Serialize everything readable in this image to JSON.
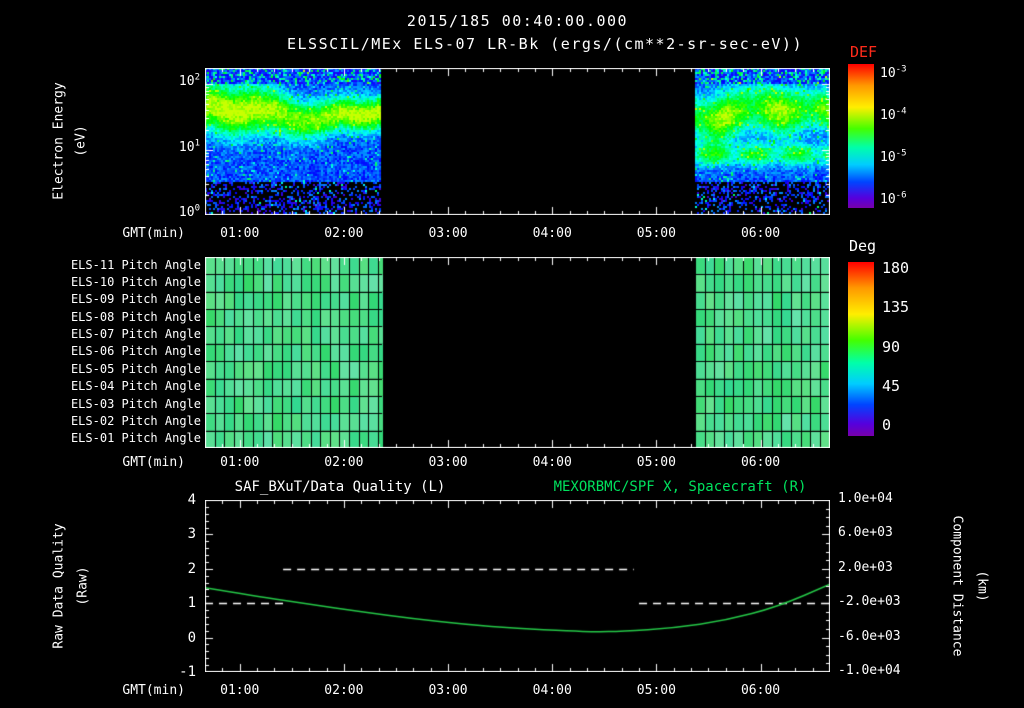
{
  "header": {
    "timestamp": "2015/185 00:40:00.000",
    "title": "ELSSCIL/MEx ELS-07 LR-Bk (ergs/(cm**2-sr-sec-eV))"
  },
  "colors": {
    "background": "#000000",
    "text": "#ffffff",
    "def_label_red": "#ff2b1a",
    "right_title_green": "#00e25e",
    "curve_green": "#25c948",
    "pitch_green": "#57e393"
  },
  "panels": {
    "spectrogram": {
      "ylabel_line1": "Electron Energy",
      "ylabel_line2": "(eV)",
      "xlabel": "GMT(min)",
      "x_ticks": [
        "01:00",
        "02:00",
        "03:00",
        "04:00",
        "05:00",
        "06:00"
      ],
      "y_ticks": [
        {
          "base": "10",
          "exp": "2"
        },
        {
          "base": "10",
          "exp": "1"
        },
        {
          "base": "10",
          "exp": "0"
        }
      ],
      "colorbar_label": "DEF",
      "colorbar_ticks": [
        {
          "base": "10",
          "exp": "-3"
        },
        {
          "base": "10",
          "exp": "-4"
        },
        {
          "base": "10",
          "exp": "-5"
        },
        {
          "base": "10",
          "exp": "-6"
        }
      ]
    },
    "pitch": {
      "row_labels": [
        "ELS-11 Pitch Angle",
        "ELS-10 Pitch Angle",
        "ELS-09 Pitch Angle",
        "ELS-08 Pitch Angle",
        "ELS-07 Pitch Angle",
        "ELS-06 Pitch Angle",
        "ELS-05 Pitch Angle",
        "ELS-04 Pitch Angle",
        "ELS-03 Pitch Angle",
        "ELS-02 Pitch Angle",
        "ELS-01 Pitch Angle"
      ],
      "xlabel": "GMT(min)",
      "x_ticks": [
        "01:00",
        "02:00",
        "03:00",
        "04:00",
        "05:00",
        "06:00"
      ],
      "colorbar_label": "Deg",
      "colorbar_ticks": [
        "180",
        "135",
        "90",
        "45",
        "0"
      ]
    },
    "timeseries": {
      "title_left": "SAF_BXuT/Data Quality (L)",
      "title_right": "MEXORBMC/SPF X, Spacecraft (R)",
      "xlabel": "GMT(min)",
      "x_ticks": [
        "01:00",
        "02:00",
        "03:00",
        "04:00",
        "05:00",
        "06:00"
      ],
      "left_ticks": [
        "4",
        "3",
        "2",
        "1",
        "0",
        "-1"
      ],
      "right_ticks": [
        "1.0e+04",
        "6.0e+03",
        "2.0e+03",
        "-2.0e+03",
        "-6.0e+03",
        "-1.0e+04"
      ],
      "ylabel_left_line1": "Raw Data Quality",
      "ylabel_left_line2": "(Raw)",
      "ylabel_right_line1": "Component Distance",
      "ylabel_right_line2": "(km)"
    }
  },
  "chart_data": [
    {
      "type": "heatmap",
      "panel": "electron-energy-spectrogram",
      "title": "ELSSCIL/MEx ELS-07 LR-Bk",
      "units": "ergs/(cm**2-sr-sec-eV)",
      "date": "2015/185",
      "start_time": "00:40:00.000",
      "xlabel": "GMT(min)",
      "x_start": "00:40",
      "x_end": "06:40",
      "x_tick_labels": [
        "01:00",
        "02:00",
        "03:00",
        "04:00",
        "05:00",
        "06:00"
      ],
      "ylabel": "Electron Energy (eV)",
      "y_scale": "log",
      "y_min_ev": 1,
      "y_max_ev": 178,
      "colorbar": {
        "label": "DEF",
        "min": "1e-6",
        "max": "1e-3",
        "scale": "log",
        "palette": "rainbow"
      },
      "coverage_fraction": [
        [
          0.0,
          0.283
        ],
        [
          0.784,
          1.0
        ]
      ],
      "coverage_gmt": [
        [
          "00:40",
          "02:22"
        ],
        [
          "05:22",
          "06:40"
        ]
      ],
      "features": [
        "bright green-yellow band ~20-70 eV at flux ~1e-4",
        "blue-violet background at ~1e-5 to 1e-6",
        "mostly black below ~3 eV",
        "weak secondary green band near 8 eV in second data segment",
        "data gap (black) between ~02:22 and ~05:22"
      ]
    },
    {
      "type": "heatmap",
      "panel": "pitch-angle-grid",
      "rows": [
        "ELS-11 Pitch Angle",
        "ELS-10 Pitch Angle",
        "ELS-09 Pitch Angle",
        "ELS-08 Pitch Angle",
        "ELS-07 Pitch Angle",
        "ELS-06 Pitch Angle",
        "ELS-05 Pitch Angle",
        "ELS-04 Pitch Angle",
        "ELS-03 Pitch Angle",
        "ELS-02 Pitch Angle",
        "ELS-01 Pitch Angle"
      ],
      "colorbar": {
        "label": "Deg",
        "min": 0,
        "max": 180,
        "ticks": [
          0,
          45,
          90,
          135,
          180
        ],
        "palette": "rainbow"
      },
      "value_deg_approx": 95,
      "coverage_fraction": [
        [
          0.0,
          0.283
        ],
        [
          0.784,
          1.0
        ]
      ],
      "x_tick_labels": [
        "01:00",
        "02:00",
        "03:00",
        "04:00",
        "05:00",
        "06:00"
      ]
    },
    {
      "type": "line",
      "panel": "quality-and-distance",
      "xlabel": "GMT(min)",
      "x_start": "00:40",
      "x_end": "06:40",
      "x_tick_labels": [
        "01:00",
        "02:00",
        "03:00",
        "04:00",
        "05:00",
        "06:00"
      ],
      "left_axis": {
        "label": "Raw Data Quality (Raw)",
        "min": -1,
        "max": 4,
        "ticks": [
          4,
          3,
          2,
          1,
          0,
          -1
        ]
      },
      "right_axis": {
        "label": "Component Distance (km)",
        "min": -10000,
        "max": 10000,
        "ticks": [
          10000,
          6000,
          2000,
          -2000,
          -6000,
          -10000
        ]
      },
      "series": [
        {
          "name": "SAF_BXuT/Data Quality (L)",
          "axis": "left",
          "color": "#ffffff",
          "style": "dashed",
          "segments": [
            {
              "from_min": 0,
              "to_min": 45,
              "value": 1
            },
            {
              "from_min": 45,
              "to_min": 247,
              "value": 2
            },
            {
              "from_min": 250,
              "to_min": 360,
              "value": 1
            }
          ]
        },
        {
          "name": "MEXORBMC/SPF X, Spacecraft (R)",
          "axis": "right",
          "color": "#25c948",
          "style": "solid",
          "x_min": [
            0,
            30,
            60,
            90,
            120,
            150,
            180,
            210,
            225,
            240,
            270,
            300,
            330,
            360
          ],
          "y_km": [
            -200,
            -1200,
            -2120,
            -3000,
            -3800,
            -4480,
            -4960,
            -5240,
            -5320,
            -5280,
            -4880,
            -4000,
            -2400,
            200
          ]
        }
      ]
    }
  ]
}
